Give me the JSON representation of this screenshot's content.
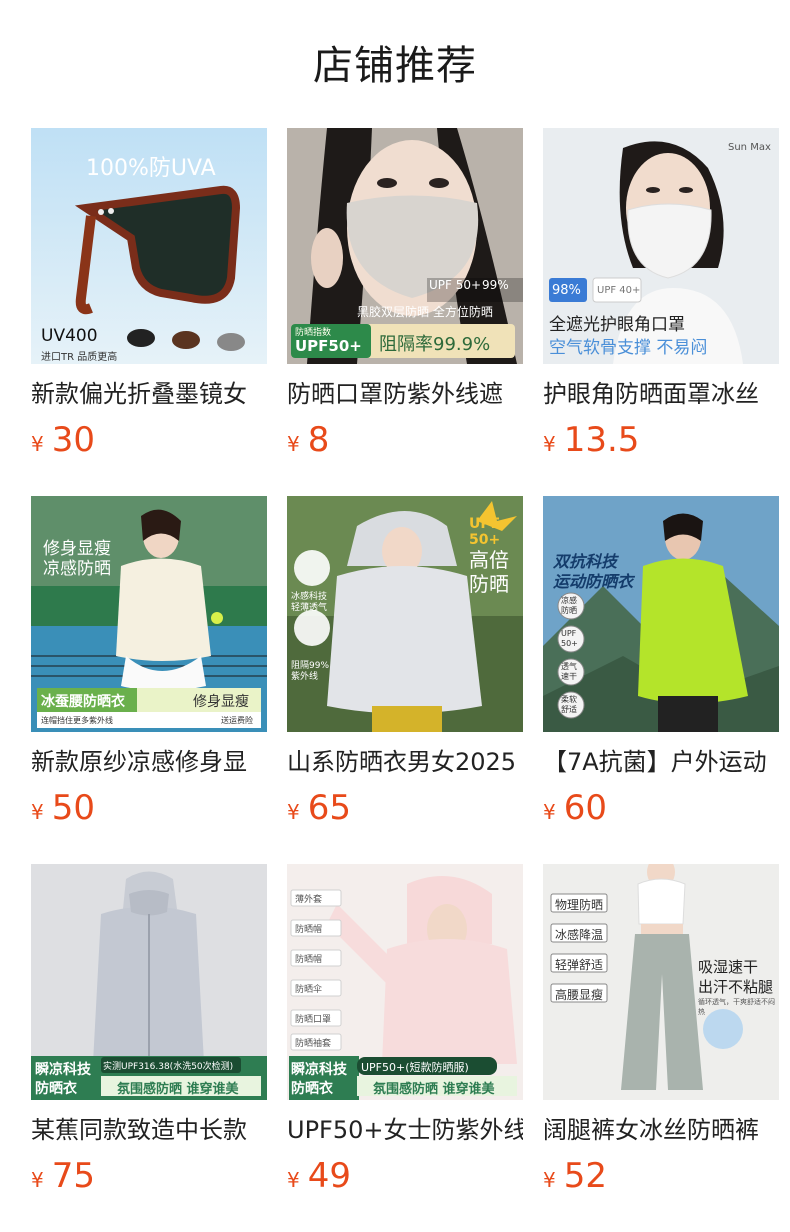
{
  "page": {
    "title": "店铺推荐"
  },
  "currency_symbol": "¥",
  "products": [
    {
      "title": "新款偏光折叠墨镜女",
      "price": "30",
      "image_text": {
        "headline": "100%防UVA",
        "badge": "UV400",
        "sub": "进口TR 品质更高"
      },
      "icon": "sunglasses-image"
    },
    {
      "title": "防晒口罩防紫外线遮",
      "price": "8",
      "image_text": {
        "upf": "UPF 50+",
        "rate": "99%",
        "tag": "黑胶双层防晒 全方位防晒",
        "badge": "UPF50+",
        "badge_sub": "防晒指数",
        "block": "阻隔率99.9%"
      },
      "icon": "face-mask-image"
    },
    {
      "title": "护眼角防晒面罩冰丝",
      "price": "13.5",
      "image_text": {
        "brand": "Sun Max",
        "p1": "98%",
        "p2": "UPF 40+",
        "line1": "全遮光护眼角口罩",
        "line2": "空气软骨支撑 不易闷"
      },
      "icon": "sun-mask-image"
    },
    {
      "title": "新款原纱凉感修身显",
      "price": "50",
      "image_text": {
        "headline1": "修身显瘦",
        "headline2": "凉感防晒",
        "badge": "冰蚕腰防晒衣",
        "badge2": "修身显瘦",
        "sub1": "连帽挡住更多紫外线",
        "sub2": "送运费险"
      },
      "icon": "tennis-jacket-image"
    },
    {
      "title": "山系防晒衣男女2025",
      "price": "65",
      "image_text": {
        "upf": "UPF 50+",
        "big1": "高倍",
        "big2": "防晒",
        "f1": "冰感科技",
        "f2": "轻薄透气",
        "f3": "阻隔99%",
        "f4": "紫外线"
      },
      "icon": "hooded-jacket-image"
    },
    {
      "title": "【7A抗菌】户外运动",
      "price": "60",
      "image_text": {
        "headline1": "双抗科技",
        "headline2": "运动防晒衣",
        "c1": "凉感防晒",
        "c2": "UPF 50+",
        "c3": "透气速干",
        "c4": "柔软舒适"
      },
      "icon": "sport-jacket-image"
    },
    {
      "title": "某蕉同款致造中长款",
      "price": "75",
      "image_text": {
        "badge1": "瞬凉科技",
        "badge2": "防晒衣",
        "test": "实测UPF316.38(水洗50次检测)",
        "slogan": "氛围感防晒 谁穿谁美"
      },
      "icon": "long-coat-image"
    },
    {
      "title": "UPF50+女士防紫外线",
      "price": "49",
      "image_text": {
        "i1": "薄外套",
        "i2": "防晒帽",
        "i3": "防晒帽",
        "i4": "防晒伞",
        "i5": "防晒口罩",
        "i6": "防晒袖套",
        "badge1": "瞬凉科技",
        "badge2": "防晒衣",
        "upf": "UPF50+(短款防晒服)",
        "slogan": "氛围感防晒 谁穿谁美"
      },
      "icon": "pink-hoodie-image"
    },
    {
      "title": "阔腿裤女冰丝防晒裤",
      "price": "52",
      "image_text": {
        "t1": "物理防晒",
        "t2": "冰感降温",
        "t3": "轻弹舒适",
        "t4": "高腰显瘦",
        "big1": "吸湿速干",
        "big2": "出汗不粘腿",
        "sub": "循环透气，干爽舒适不闷热"
      },
      "icon": "wide-pants-image"
    }
  ],
  "colors": {
    "price": "#e84a1a",
    "title": "#222222"
  }
}
